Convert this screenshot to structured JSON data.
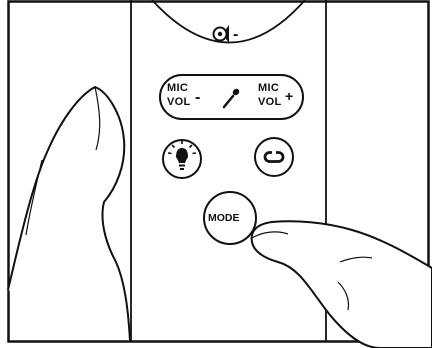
{
  "remote": {
    "volume_symbol": "-",
    "mic_minus": {
      "line1": "MIC",
      "line2": "VOL",
      "sign": "-"
    },
    "mic_plus": {
      "line1": "MIC",
      "line2": "VOL",
      "sign": "+"
    },
    "mode_label": "MODE",
    "icons": {
      "speaker": "speaker-icon",
      "microphone": "microphone-icon",
      "light": "light-bulb-icon",
      "loop": "loop-icon"
    }
  },
  "colors": {
    "line": "#111111",
    "background": "#ffffff"
  }
}
